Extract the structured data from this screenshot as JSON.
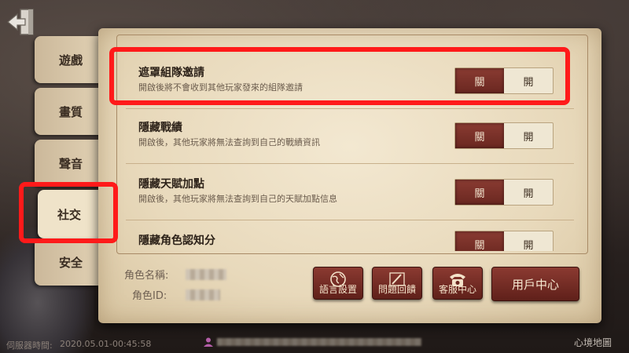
{
  "tabs": [
    {
      "label": "遊戲"
    },
    {
      "label": "畫質"
    },
    {
      "label": "聲音"
    },
    {
      "label": "社交"
    },
    {
      "label": "安全"
    }
  ],
  "rows": [
    {
      "title": "遮罩組隊邀請",
      "desc": "開啟後將不會收到其他玩家發來的組隊邀請",
      "off": "關",
      "on": "開",
      "selected": "關"
    },
    {
      "title": "隱藏戰績",
      "desc": "開啟後，其他玩家將無法查詢到自己的戰績資訊",
      "off": "關",
      "on": "開",
      "selected": "關"
    },
    {
      "title": "隱藏天賦加點",
      "desc": "開啟後，其他玩家將無法查詢到自己的天賦加點信息",
      "off": "關",
      "on": "開",
      "selected": "關"
    },
    {
      "title": "隱藏角色認知分",
      "off": "關",
      "on": "開",
      "selected": "關"
    }
  ],
  "info": {
    "name_label": "角色名稱:",
    "id_label": "角色ID:"
  },
  "buttons": {
    "language": "語言設置",
    "feedback": "問題回饋",
    "support": "客服中心",
    "user_center": "用戶中心"
  },
  "footer": {
    "server_time_label": "伺服器時間:",
    "server_time": "2020.05.01-00:45:58",
    "map": "心境地圖"
  },
  "colors": {
    "highlight": "#ff1a1a",
    "toggle_on": "#7a2f27",
    "panel": "#efe3c9"
  }
}
